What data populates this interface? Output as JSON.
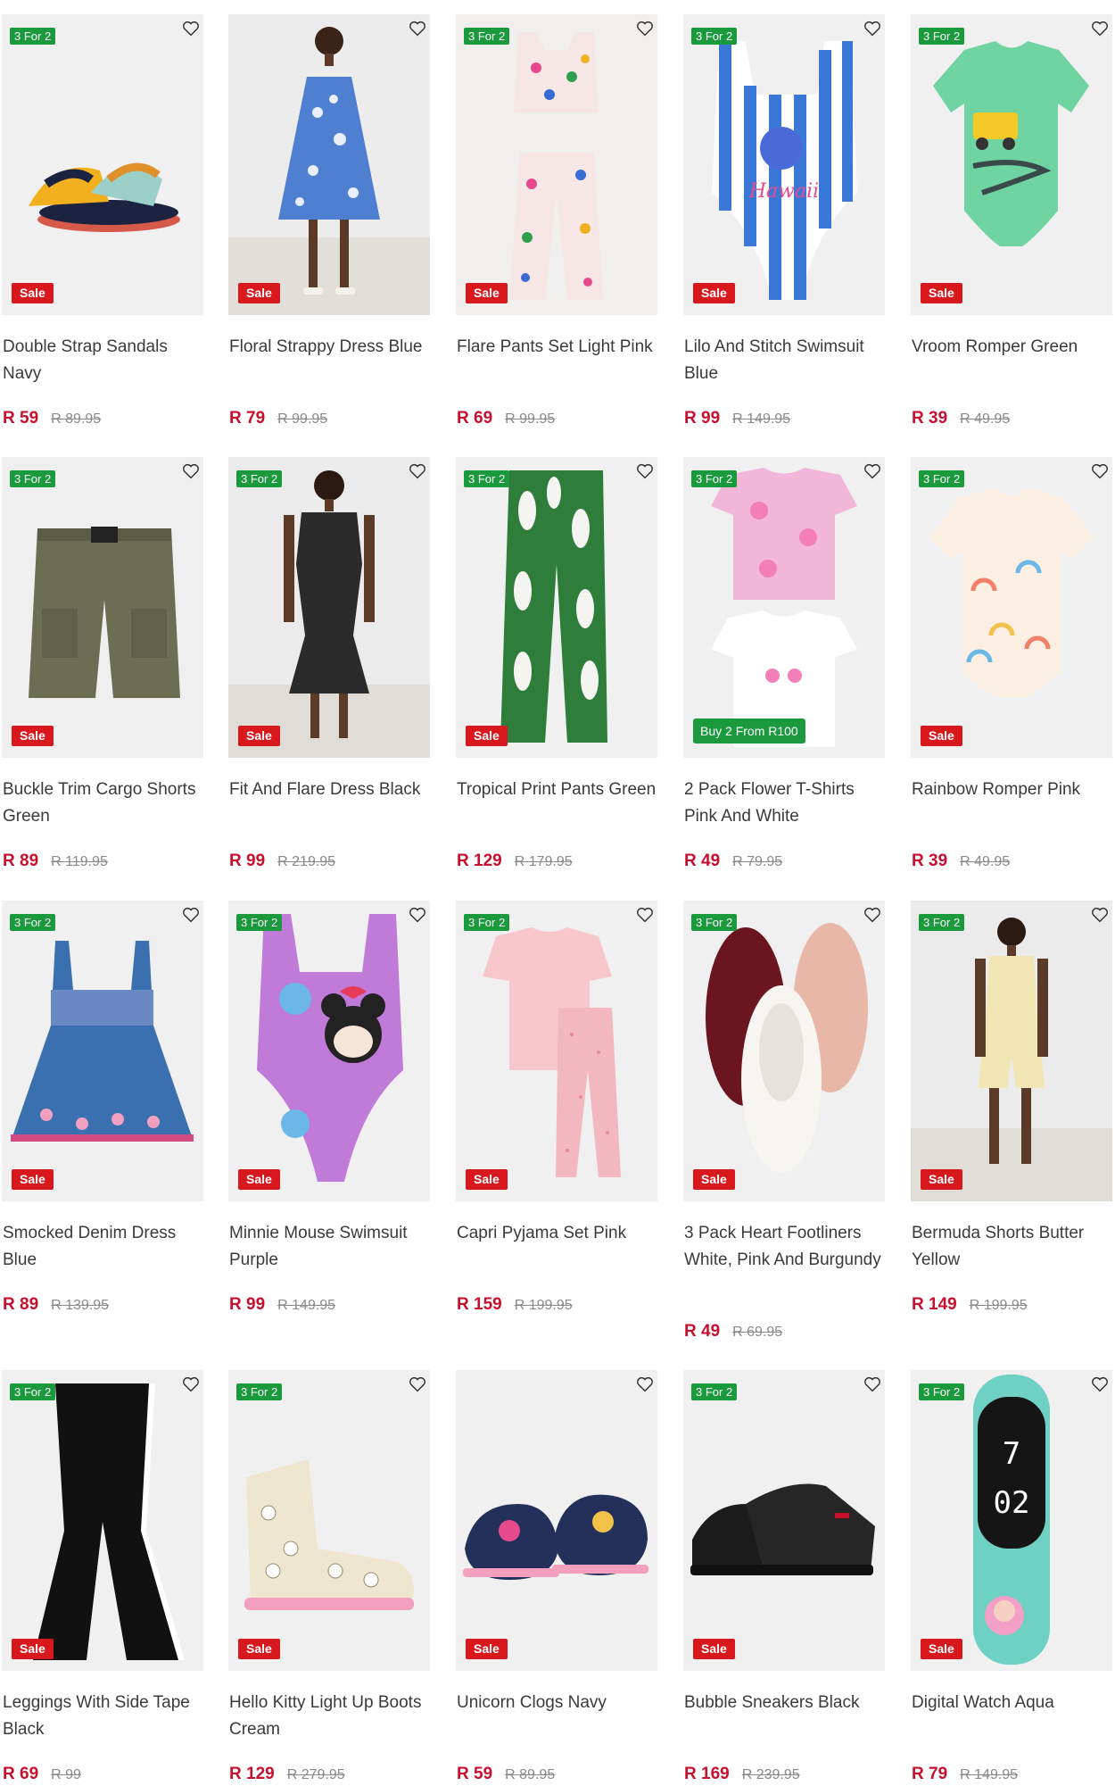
{
  "colors": {
    "promo": "#1a9a3c",
    "sale": "#d7191e",
    "price": "#c8102e",
    "original": "#8a8a8a"
  },
  "products": [
    {
      "name": "Double Strap Sandals Navy",
      "price": "R 59",
      "original": "R 89.95",
      "promo": "3 For 2",
      "sale": "Sale",
      "icon": "sandals-image"
    },
    {
      "name": "Floral Strappy Dress Blue",
      "price": "R 79",
      "original": "R 99.95",
      "promo": "",
      "sale": "Sale",
      "icon": "dress-image"
    },
    {
      "name": "Flare Pants Set Light Pink",
      "price": "R 69",
      "original": "R 99.95",
      "promo": "3 For 2",
      "sale": "Sale",
      "icon": "pants-set-image"
    },
    {
      "name": "Lilo And Stitch Swimsuit Blue",
      "price": "R 99",
      "original": "R 149.95",
      "promo": "3 For 2",
      "sale": "Sale",
      "icon": "swimsuit-image"
    },
    {
      "name": "Vroom Romper Green",
      "price": "R 39",
      "original": "R 49.95",
      "promo": "3 For 2",
      "sale": "Sale",
      "icon": "romper-image"
    },
    {
      "name": "Buckle Trim Cargo Shorts Green",
      "price": "R 89",
      "original": "R 119.95",
      "promo": "3 For 2",
      "sale": "Sale",
      "icon": "shorts-image"
    },
    {
      "name": "Fit And Flare Dress Black",
      "price": "R 99",
      "original": "R 219.95",
      "promo": "3 For 2",
      "sale": "Sale",
      "icon": "dress-image"
    },
    {
      "name": "Tropical Print Pants Green",
      "price": "R 129",
      "original": "R 179.95",
      "promo": "3 For 2",
      "sale": "Sale",
      "icon": "pants-image"
    },
    {
      "name": "2 Pack Flower T-Shirts Pink And White",
      "price": "R 49",
      "original": "R 79.95",
      "promo": "3 For 2",
      "sale": "",
      "extra": "Buy 2 From R100",
      "icon": "tshirts-image"
    },
    {
      "name": "Rainbow Romper Pink",
      "price": "R 39",
      "original": "R 49.95",
      "promo": "3 For 2",
      "sale": "Sale",
      "icon": "romper-image"
    },
    {
      "name": "Smocked Denim Dress Blue",
      "price": "R 89",
      "original": "R 139.95",
      "promo": "3 For 2",
      "sale": "Sale",
      "icon": "kids-dress-image"
    },
    {
      "name": "Minnie Mouse Swimsuit Purple",
      "price": "R 99",
      "original": "R 149.95",
      "promo": "3 For 2",
      "sale": "Sale",
      "icon": "swimsuit-image"
    },
    {
      "name": "Capri Pyjama Set Pink",
      "price": "R 159",
      "original": "R 199.95",
      "promo": "3 For 2",
      "sale": "Sale",
      "icon": "pyjama-image"
    },
    {
      "name": "3 Pack Heart Footliners White, Pink And Burgundy",
      "price": "R 49",
      "original": "R 69.95",
      "promo": "3 For 2",
      "sale": "Sale",
      "icon": "footliners-image"
    },
    {
      "name": "Bermuda Shorts Butter Yellow",
      "price": "R 149",
      "original": "R 199.95",
      "promo": "3 For 2",
      "sale": "Sale",
      "icon": "outfit-image"
    },
    {
      "name": "Leggings With Side Tape Black",
      "price": "R 69",
      "original": "R 99",
      "promo": "3 For 2",
      "sale": "Sale",
      "icon": "leggings-image"
    },
    {
      "name": "Hello Kitty Light Up Boots Cream",
      "price": "R 129",
      "original": "R 279.95",
      "promo": "3 For 2",
      "sale": "Sale",
      "icon": "boots-image"
    },
    {
      "name": "Unicorn Clogs Navy",
      "price": "R 59",
      "original": "R 89.95",
      "promo": "",
      "sale": "Sale",
      "icon": "clogs-image"
    },
    {
      "name": "Bubble Sneakers Black",
      "price": "R 169",
      "original": "R 239.95",
      "promo": "3 For 2",
      "sale": "Sale",
      "icon": "sneakers-image"
    },
    {
      "name": "Digital Watch Aqua",
      "price": "R 79",
      "original": "R 149.95",
      "promo": "3 For 2",
      "sale": "Sale",
      "icon": "watch-image",
      "watch_display": [
        "7",
        "02"
      ]
    }
  ]
}
